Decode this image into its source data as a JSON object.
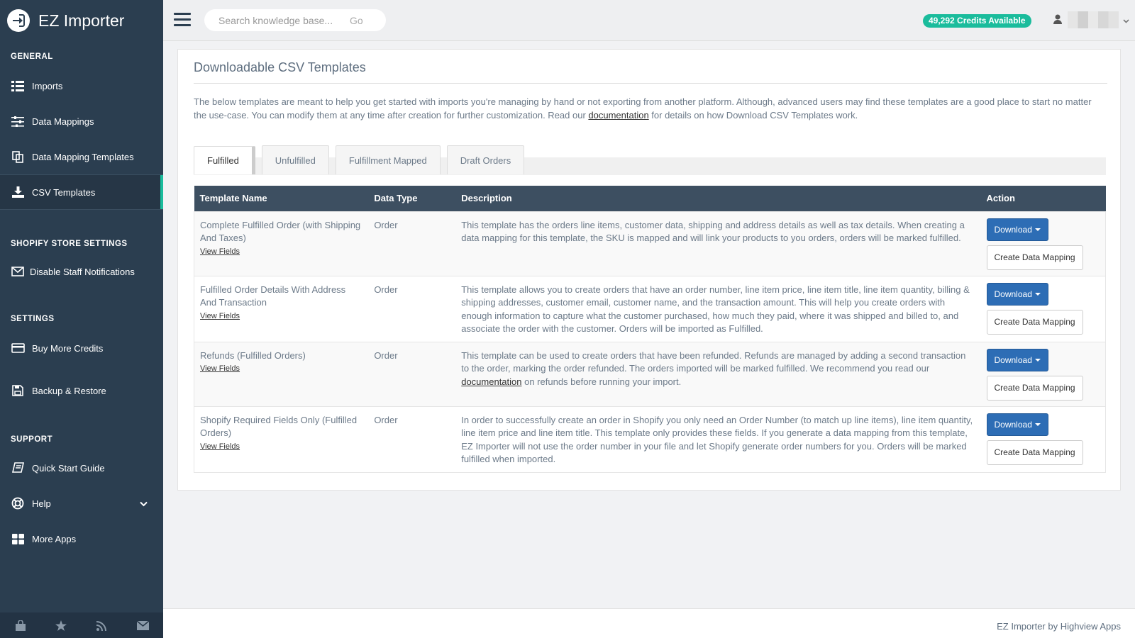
{
  "app": {
    "title": "EZ Importer"
  },
  "sidebar": {
    "sections": [
      {
        "title": "GENERAL",
        "items": [
          {
            "label": "Imports",
            "icon": "list-icon"
          },
          {
            "label": "Data Mappings",
            "icon": "sliders-icon"
          },
          {
            "label": "Data Mapping Templates",
            "icon": "copy-icon"
          },
          {
            "label": "CSV Templates",
            "icon": "download-icon",
            "active": true
          }
        ]
      },
      {
        "title": "SHOPIFY STORE SETTINGS",
        "items": [
          {
            "label": "Disable Staff Notifications",
            "icon": "envelope-icon"
          }
        ]
      },
      {
        "title": "SETTINGS",
        "items": [
          {
            "label": "Buy More Credits",
            "icon": "credit-card-icon"
          },
          {
            "label": "Backup & Restore",
            "icon": "save-icon"
          }
        ]
      },
      {
        "title": "SUPPORT",
        "items": [
          {
            "label": "Quick Start Guide",
            "icon": "book-icon"
          },
          {
            "label": "Help",
            "icon": "life-ring-icon",
            "has_chevron": true
          },
          {
            "label": "More Apps",
            "icon": "grid-icon"
          }
        ]
      }
    ],
    "footer_icons": [
      "shop-icon",
      "star-icon",
      "rss-icon",
      "mail-icon"
    ]
  },
  "topbar": {
    "search_placeholder": "Search knowledge base...",
    "search_go": "Go",
    "credits": "49,292 Credits Available"
  },
  "panel": {
    "title": "Downloadable CSV Templates",
    "intro_before": "The below templates are meant to help you get started with imports you're managing by hand or not exporting from another platform. Although, advanced users may find these templates are a good place to start no matter the use-case. You can modify them at any time after creation for further customization. Read our ",
    "intro_link": "documentation",
    "intro_after": " for details on how Download CSV Templates work."
  },
  "tabs": [
    {
      "label": "Fulfilled",
      "active": true
    },
    {
      "label": "Unfulfilled"
    },
    {
      "label": "Fulfillment Mapped"
    },
    {
      "label": "Draft Orders"
    }
  ],
  "table": {
    "headers": {
      "name": "Template Name",
      "type": "Data Type",
      "desc": "Description",
      "action": "Action"
    },
    "view_fields": "View Fields",
    "download_label": "Download",
    "create_mapping_label": "Create Data Mapping",
    "rows": [
      {
        "name": "Complete Fulfilled Order (with Shipping And Taxes)",
        "type": "Order",
        "desc": "This template has the orders line items, customer data, shipping and address details as well as tax details. When creating a data mapping for this template, the SKU is mapped and will link your products to you orders, orders will be marked fulfilled."
      },
      {
        "name": "Fulfilled Order Details With Address And Transaction",
        "type": "Order",
        "desc": "This template allows you to create orders that have an order number, line item price, line item title, line item quantity, billing & shipping addresses, customer email, customer name, and the transaction amount. This will help you create orders with enough information to capture what the customer purchased, how much they paid, where it was shipped and billed to, and associate the order with the customer. Orders will be imported as Fulfilled."
      },
      {
        "name": "Refunds (Fulfilled Orders)",
        "type": "Order",
        "desc": "This template can be used to create orders that have been refunded. Refunds are managed by adding a second transaction to the order, marking the order refunded. The orders imported will be marked fulfilled. We recommend you read our ",
        "desc_link": "documentation",
        "desc_after": " on refunds before running your import."
      },
      {
        "name": "Shopify Required Fields Only (Fulfilled Orders)",
        "type": "Order",
        "desc": "In order to successfully create an order in Shopify you only need an Order Number (to match up line items), line item quantity, line item price and line item title. This template only provides these fields. If you generate a data mapping from this template, EZ Importer will not use the order number in your file and let Shopify generate order numbers for you. Orders will be marked fulfilled when imported."
      }
    ]
  },
  "footer": {
    "text": "EZ Importer by Highview Apps"
  }
}
